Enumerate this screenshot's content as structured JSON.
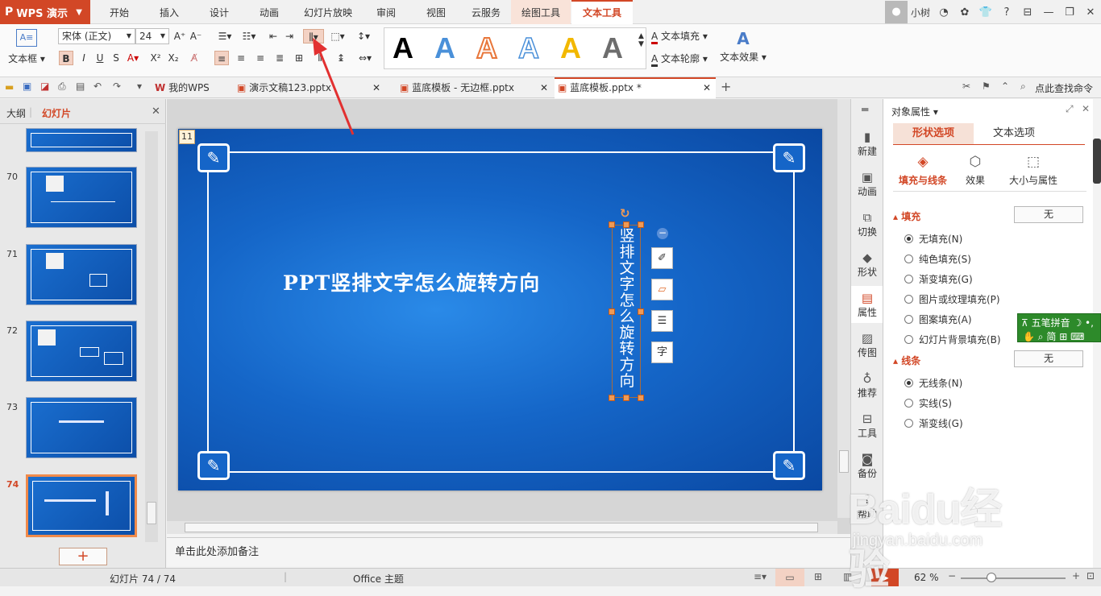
{
  "app": {
    "logo": "WPS 演示"
  },
  "menu_tabs": [
    "开始",
    "插入",
    "设计",
    "动画",
    "幻灯片放映",
    "审阅",
    "视图",
    "云服务",
    "绘图工具",
    "文本工具"
  ],
  "active_tab": "文本工具",
  "user": {
    "name": "小树"
  },
  "ribbon": {
    "textbox_label": "文本框",
    "font_name": "宋体 (正文)",
    "font_size": "24",
    "text_fill": "文本填充",
    "text_outline": "文本轮廓",
    "text_effect": "文本效果",
    "style_colors": [
      "#000000",
      "#4a90d9",
      "#e8763a",
      "#4a90d9",
      "#f2b800",
      "#666666"
    ]
  },
  "doc_tabs": [
    {
      "label": "我的WPS"
    },
    {
      "label": "演示文稿123.pptx"
    },
    {
      "label": "蓝底模板 - 无边框.pptx"
    },
    {
      "label": "蓝底模板.pptx *"
    }
  ],
  "search_placeholder": "点此查找命令",
  "left_panel": {
    "tab_outline": "大纲",
    "tab_slides": "幻灯片",
    "slides": [
      {
        "num": "70"
      },
      {
        "num": "71"
      },
      {
        "num": "72"
      },
      {
        "num": "73"
      },
      {
        "num": "74"
      }
    ],
    "add_button": "+"
  },
  "slide": {
    "page_badge": "11",
    "title": "PPT竖排文字怎么旋转方向",
    "vertical_text": "竖排文字怎么旋转方向"
  },
  "notes_placeholder": "单击此处添加备注",
  "status": {
    "slide_counter": "幻灯片 74 / 74",
    "theme": "Office 主题",
    "zoom": "62 %"
  },
  "right_strip": [
    "新建",
    "动画",
    "切换",
    "形状",
    "属性",
    "传图",
    "推荐",
    "工具",
    "备份",
    "帮助"
  ],
  "properties": {
    "header": "对象属性",
    "tab_shape": "形状选项",
    "tab_text": "文本选项",
    "sub_fill_line": "填充与线条",
    "sub_effect": "效果",
    "sub_size": "大小与属性",
    "fill_section": "填充",
    "fill_value": "无",
    "fill_options": [
      "无填充(N)",
      "纯色填充(S)",
      "渐变填充(G)",
      "图片或纹理填充(P)",
      "图案填充(A)",
      "幻灯片背景填充(B)"
    ],
    "line_section": "线条",
    "line_value": "无",
    "line_options": [
      "无线条(N)",
      "实线(S)",
      "渐变线(G)"
    ]
  },
  "ime": {
    "label": "五笔拼音",
    "mode": "简"
  },
  "watermark": {
    "brand": "Baidu经验",
    "url": "jingyan.baidu.com"
  }
}
